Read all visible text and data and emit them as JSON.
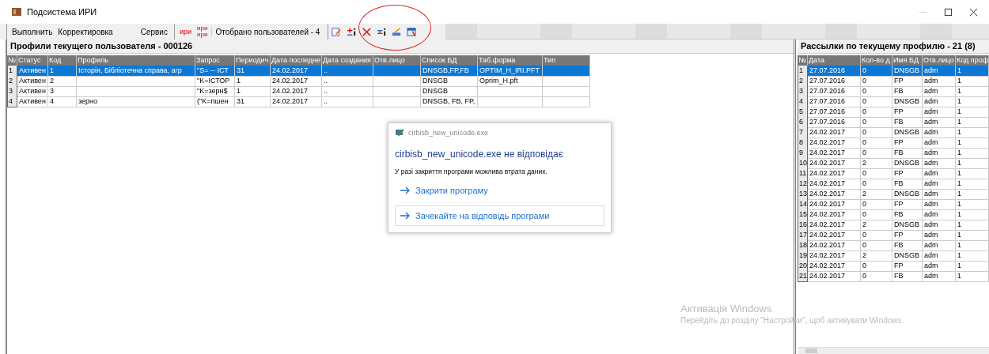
{
  "window": {
    "title": "Подсистема ИРИ"
  },
  "toolbar": {
    "menu": [
      "Выполнить",
      "Корректировка",
      "Сервис"
    ],
    "iri_buttons": [
      {
        "kind": "single",
        "labels": [
          "ири"
        ]
      },
      {
        "kind": "double",
        "labels": [
          "ири",
          "ири"
        ]
      }
    ],
    "users_count": "Отобрано пользователей - 4"
  },
  "profiles": {
    "title": "Профили текущего пользователя - 000126",
    "columns": [
      "№",
      "Статус",
      "Код",
      "Профиль",
      "Запрос",
      "Периодич",
      "Дата последне",
      "Дата создания",
      "Отв.лицо",
      "Список БД",
      "Таб.форма",
      "Тип"
    ],
    "rows": [
      {
        "selected": true,
        "cells": [
          "1",
          "Активен",
          "1",
          "Історія, Бібліотечна справа, агр",
          "\"S= -- ІСТ",
          "31",
          "24.02.2017",
          "..",
          "",
          "DNSGB,FP,FB",
          "OPTIM_H_IRI.PFT",
          ""
        ]
      },
      {
        "selected": false,
        "cells": [
          "2",
          "Активен",
          "2",
          "",
          "\"K=ІСТОР",
          "1",
          "24.02.2017",
          "..",
          "",
          "DNSGB",
          "Oprim_H.pft",
          ""
        ]
      },
      {
        "selected": false,
        "cells": [
          "3",
          "Активен",
          "3",
          "",
          "\"K=зерн$",
          "1",
          "24.02.2017",
          "..",
          "",
          "DNSGB",
          "",
          ""
        ]
      },
      {
        "selected": false,
        "cells": [
          "4",
          "Активен",
          "4",
          "зерно",
          "(\"K=пшен",
          "31",
          "24.02.2017",
          "..",
          "",
          "DNSGB, FB, FP,",
          "",
          ""
        ]
      }
    ]
  },
  "mailings": {
    "title": "Рассылки по текущему профилю - 21 (8)",
    "columns": [
      "№",
      "Дата",
      "Кол-во д",
      "Имя БД",
      "Отв.лицо",
      "Код проф"
    ],
    "rows": [
      {
        "selected": true,
        "cells": [
          "1",
          "27.07.2016",
          "0",
          "DNSGB",
          "adm",
          "1"
        ]
      },
      {
        "selected": false,
        "cells": [
          "2",
          "27.07.2016",
          "0",
          "FP",
          "adm",
          "1"
        ]
      },
      {
        "selected": false,
        "cells": [
          "3",
          "27.07.2016",
          "0",
          "FB",
          "adm",
          "1"
        ]
      },
      {
        "selected": false,
        "cells": [
          "4",
          "27.07.2016",
          "0",
          "DNSGB",
          "adm",
          "1"
        ]
      },
      {
        "selected": false,
        "cells": [
          "5",
          "27.07.2016",
          "0",
          "FP",
          "adm",
          "1"
        ]
      },
      {
        "selected": false,
        "cells": [
          "6",
          "27.07.2016",
          "0",
          "FB",
          "adm",
          "1"
        ]
      },
      {
        "selected": false,
        "cells": [
          "7",
          "24.02.2017",
          "0",
          "DNSGB",
          "adm",
          "1"
        ]
      },
      {
        "selected": false,
        "cells": [
          "8",
          "24.02.2017",
          "0",
          "FP",
          "adm",
          "1"
        ]
      },
      {
        "selected": false,
        "cells": [
          "9",
          "24.02.2017",
          "0",
          "FB",
          "adm",
          "1"
        ]
      },
      {
        "selected": false,
        "cells": [
          "10",
          "24.02.2017",
          "2",
          "DNSGB",
          "adm",
          "1"
        ]
      },
      {
        "selected": false,
        "cells": [
          "11",
          "24.02.2017",
          "0",
          "FP",
          "adm",
          "1"
        ]
      },
      {
        "selected": false,
        "cells": [
          "12",
          "24.02.2017",
          "0",
          "FB",
          "adm",
          "1"
        ]
      },
      {
        "selected": false,
        "cells": [
          "13",
          "24.02.2017",
          "2",
          "DNSGB",
          "adm",
          "1"
        ]
      },
      {
        "selected": false,
        "cells": [
          "14",
          "24.02.2017",
          "0",
          "FP",
          "adm",
          "1"
        ]
      },
      {
        "selected": false,
        "cells": [
          "15",
          "24.02.2017",
          "0",
          "FB",
          "adm",
          "1"
        ]
      },
      {
        "selected": false,
        "cells": [
          "16",
          "24.02.2017",
          "2",
          "DNSGB",
          "adm",
          "1"
        ]
      },
      {
        "selected": false,
        "cells": [
          "17",
          "24.02.2017",
          "0",
          "FP",
          "adm",
          "1"
        ]
      },
      {
        "selected": false,
        "cells": [
          "18",
          "24.02.2017",
          "0",
          "FB",
          "adm",
          "1"
        ]
      },
      {
        "selected": false,
        "cells": [
          "19",
          "24.02.2017",
          "2",
          "DNSGB",
          "adm",
          "1"
        ]
      },
      {
        "selected": false,
        "cells": [
          "20",
          "24.02.2017",
          "0",
          "FP",
          "adm",
          "1"
        ]
      },
      {
        "selected": false,
        "cells": [
          "21",
          "24.02.2017",
          "0",
          "FB",
          "adm",
          "1"
        ]
      }
    ]
  },
  "dialog": {
    "app": "cirbisb_new_unicode.exe",
    "heading": "cirbisb_new_unicode.exe не відповідає",
    "message": "У разі закриття програми можлива втрата даних.",
    "actions": [
      {
        "label": "Закрити програму",
        "focused": false
      },
      {
        "label": "Зачекайте на відповідь програми",
        "focused": true
      }
    ]
  },
  "activation": {
    "title": "Активація Windows",
    "text": "Перейдіть до розділу \"Настройки\", щоб активувати Windows."
  }
}
